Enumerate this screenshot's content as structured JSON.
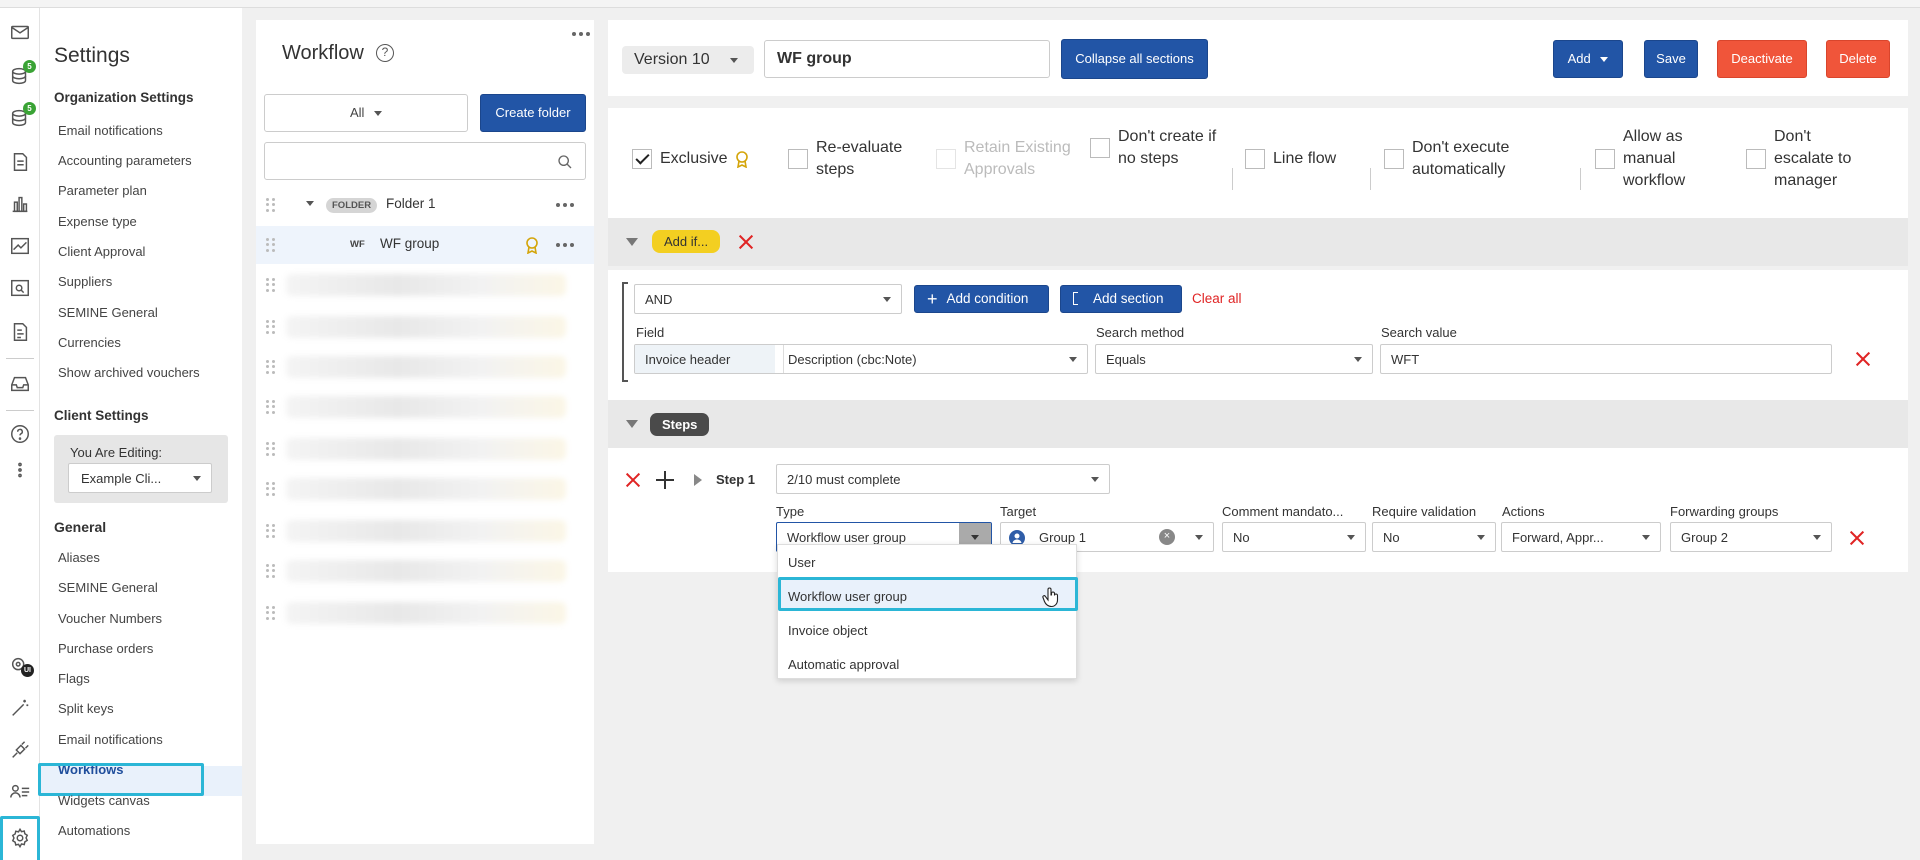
{
  "settings": {
    "title": "Settings",
    "org_title": "Organization Settings",
    "org_items": [
      "Email notifications",
      "Accounting parameters",
      "Parameter plan",
      "Expense type",
      "Client Approval",
      "Suppliers",
      "SEMINE General",
      "Currencies",
      "Show archived vouchers"
    ],
    "client_title": "Client Settings",
    "editing_label": "You Are Editing:",
    "editing_value": "Example Cli...",
    "general_title": "General",
    "general_items": [
      "Aliases",
      "SEMINE General",
      "Voucher Numbers",
      "Purchase orders",
      "Flags",
      "Split keys",
      "Email notifications",
      "Workflows",
      "Widgets canvas",
      "Automations"
    ],
    "active_item": "Workflows"
  },
  "rail": {
    "badges": [
      "5",
      "5"
    ],
    "icons": [
      "mail-icon",
      "coins-icon",
      "coins-icon",
      "document-icon",
      "bar-chart-icon",
      "line-chart-icon",
      "search-document-icon",
      "invoice-icon",
      "inbox-icon",
      "help-icon",
      "more-vertical-icon",
      "ui-settings-icon",
      "magic-wand-icon",
      "plug-icon",
      "user-list-icon",
      "gear-icon"
    ],
    "ui_badge": "UI"
  },
  "workflow_panel": {
    "title": "Workflow",
    "help": "?",
    "filter_value": "All",
    "create_folder": "Create folder",
    "search_placeholder": "",
    "folder_tag": "FOLDER",
    "folder_name": "Folder 1",
    "wf_tag": "WF",
    "wf_name": "WF group"
  },
  "header": {
    "version": "Version 10",
    "name": "WF group",
    "collapse": "Collapse all sections",
    "add": "Add",
    "save": "Save",
    "deactivate": "Deactivate",
    "delete": "Delete"
  },
  "options": [
    {
      "label": "Exclusive",
      "checked": true,
      "disabled": false
    },
    {
      "label": "Re-evaluate steps",
      "checked": false,
      "disabled": false
    },
    {
      "label": "Retain Existing Approvals",
      "checked": false,
      "disabled": true
    },
    {
      "label": "Don't create if no steps",
      "checked": false,
      "disabled": false
    },
    {
      "label": "Line flow",
      "checked": false,
      "disabled": false
    },
    {
      "label": "Don't execute automatically",
      "checked": false,
      "disabled": false
    },
    {
      "label": "Allow as manual workflow",
      "checked": false,
      "disabled": false
    },
    {
      "label": "Don't escalate to manager",
      "checked": false,
      "disabled": false
    }
  ],
  "condition": {
    "section_label": "Add if...",
    "operator": "AND",
    "add_condition": "Add condition",
    "add_section": "Add section",
    "clear_all": "Clear all",
    "field_label": "Field",
    "field_prefix": "Invoice header",
    "field_value": "Description (cbc:Note)",
    "method_label": "Search method",
    "method_value": "Equals",
    "value_label": "Search value",
    "value_value": "WFT"
  },
  "steps": {
    "section_label": "Steps",
    "step_label": "Step 1",
    "completion": "2/10 must complete",
    "type_label": "Type",
    "type_value": "Workflow user group",
    "target_label": "Target",
    "target_value": "Group 1",
    "comment_label": "Comment mandato...",
    "comment_value": "No",
    "validation_label": "Require validation",
    "validation_value": "No",
    "actions_label": "Actions",
    "actions_value": "Forward, Appr...",
    "forwarding_label": "Forwarding groups",
    "forwarding_value": "Group 2"
  },
  "type_dropdown": {
    "options": [
      "User",
      "Workflow user group",
      "Invoice object",
      "Automatic approval"
    ],
    "highlighted": "Workflow user group"
  },
  "colors": {
    "primary": "#2255a6",
    "danger": "#f0553a",
    "highlight": "#2bb6d6",
    "badge": "#3aa335",
    "yellow": "#f3cf21"
  }
}
